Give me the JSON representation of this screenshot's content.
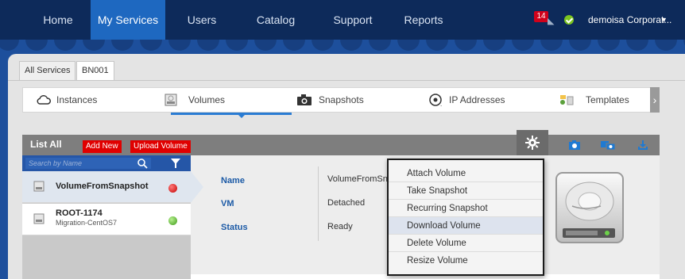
{
  "topnav": {
    "items": [
      "Home",
      "My Services",
      "Users",
      "Catalog",
      "Support",
      "Reports"
    ],
    "active": "My Services",
    "notifications": "14",
    "account": "demoisa Corporat...",
    "colors": {
      "bar": "#0d2a5a",
      "active": "#1e68c0"
    }
  },
  "tabs": [
    "All Services",
    "BN001"
  ],
  "subnav": {
    "items": [
      {
        "label": "Instances",
        "icon": "cloud-icon"
      },
      {
        "label": "Volumes",
        "icon": "volume-icon"
      },
      {
        "label": "Snapshots",
        "icon": "camera-icon"
      },
      {
        "label": "IP Addresses",
        "icon": "ip-address-icon"
      },
      {
        "label": "Templates",
        "icon": "templates-icon"
      }
    ],
    "active": "Volumes"
  },
  "list_header": {
    "title": "List All",
    "add_new": "Add New",
    "upload_volume": "Upload Volume"
  },
  "search": {
    "placeholder": "Search by Name"
  },
  "volumes": [
    {
      "name": "VolumeFromSnapshot",
      "sub": "",
      "status": "red",
      "selected": true
    },
    {
      "name": "ROOT-1174",
      "sub": "Migration-CentOS7",
      "status": "green",
      "selected": false
    }
  ],
  "details": {
    "labels": [
      "Name",
      "VM",
      "Status"
    ],
    "values": [
      "VolumeFromSnapshot",
      "Detached",
      "Ready"
    ]
  },
  "menu": {
    "items": [
      "Attach Volume",
      "Take Snapshot",
      "Recurring Snapshot",
      "Download Volume",
      "Delete Volume",
      "Resize Volume"
    ],
    "hovered": "Download Volume"
  },
  "colors": {
    "accent": "#2a7cd3",
    "red_button": "#e00000",
    "status_red": "#d0021b",
    "status_green": "#6cc04a"
  }
}
